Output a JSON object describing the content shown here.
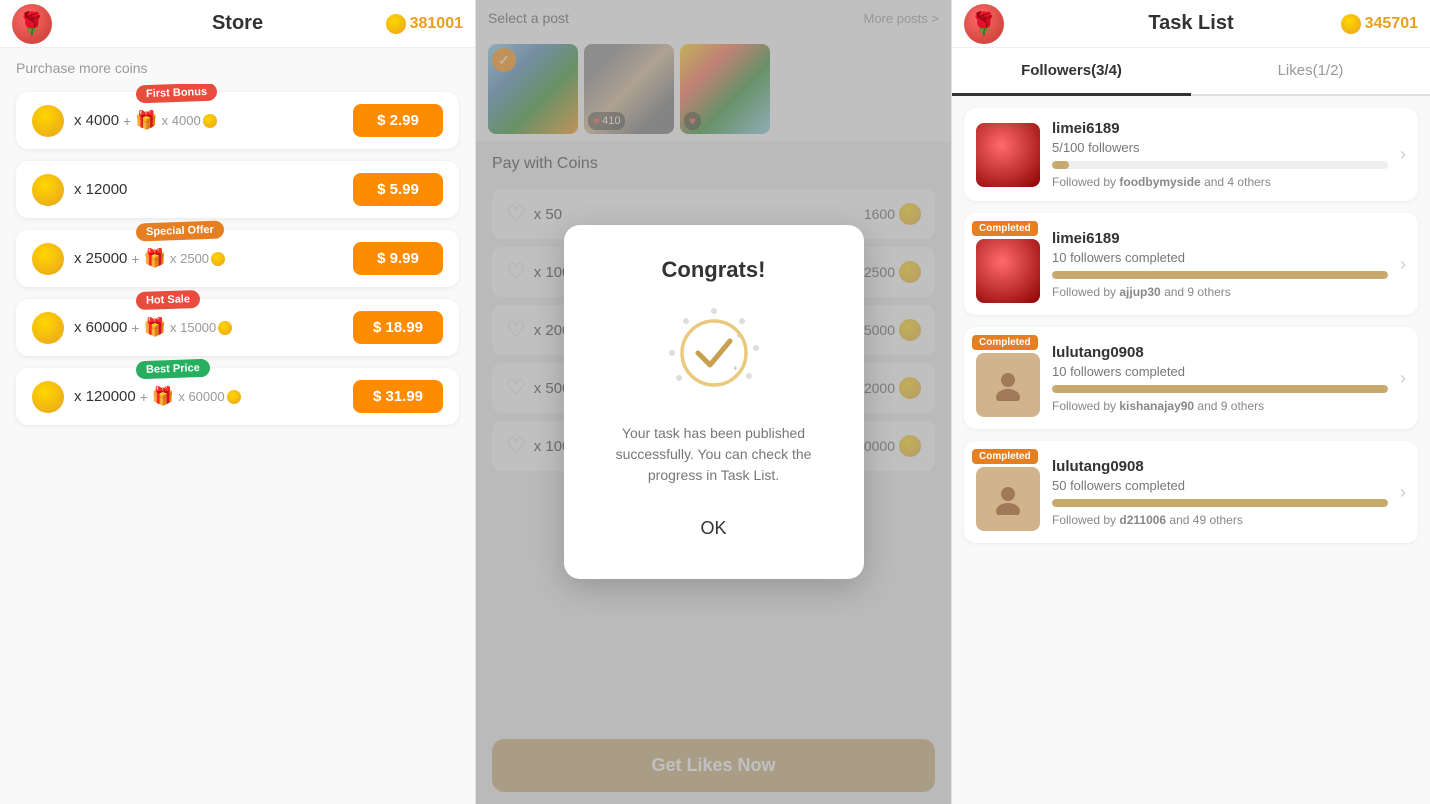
{
  "store": {
    "title": "Store",
    "logo": "🌹",
    "coins": "381001",
    "purchase_label": "Purchase more coins",
    "items": [
      {
        "amount": "x 4000",
        "bonus": "x 4000",
        "badge": "First Bonus",
        "badge_type": "first",
        "price": "$ 2.99",
        "has_gift": true
      },
      {
        "amount": "x 12000",
        "bonus": null,
        "badge": null,
        "badge_type": null,
        "price": "$ 5.99",
        "has_gift": false
      },
      {
        "amount": "x 25000",
        "bonus": "x 2500",
        "badge": "Special Offer",
        "badge_type": "special",
        "price": "$ 9.99",
        "has_gift": true
      },
      {
        "amount": "x 60000",
        "bonus": "x 15000",
        "badge": "Hot Sale",
        "badge_type": "hot",
        "price": "$ 18.99",
        "has_gift": true
      },
      {
        "amount": "x 120000",
        "bonus": "x 60000",
        "badge": "Best Price",
        "badge_type": "best",
        "price": "$ 31.99",
        "has_gift": true
      }
    ]
  },
  "middle": {
    "select_post_label": "Select a post",
    "more_posts_label": "More posts >",
    "pay_with_coins_label": "Pay with Coins",
    "get_likes_btn": "Get Likes Now",
    "likes_options": [
      {
        "count": "x 50",
        "cost": "1600"
      },
      {
        "count": "x 100",
        "cost": "2500"
      },
      {
        "count": "x 200",
        "cost": "5000"
      },
      {
        "count": "x 500",
        "cost": "12000"
      },
      {
        "count": "x 1000",
        "cost": "20000"
      }
    ]
  },
  "modal": {
    "title": "Congrats!",
    "message": "Your task has been published successfully. You can check the progress in Task List.",
    "ok_label": "OK"
  },
  "task_list": {
    "title": "Task List",
    "coins": "345701",
    "tabs": [
      {
        "label": "Followers(3/4)",
        "active": true
      },
      {
        "label": "Likes(1/2)",
        "active": false
      }
    ],
    "items": [
      {
        "username": "limei6189",
        "progress_text": "5/100 followers",
        "progress_pct": 5,
        "followers_text": "Followed by ",
        "followers_bold": "foodbymyside",
        "followers_rest": " and 4 others",
        "completed": false,
        "avatar_type": "rose"
      },
      {
        "username": "limei6189",
        "progress_text": "10 followers completed",
        "progress_pct": 100,
        "followers_text": "Followed by ",
        "followers_bold": "ajjup30",
        "followers_rest": " and 9 others",
        "completed": true,
        "avatar_type": "rose"
      },
      {
        "username": "lulutang0908",
        "progress_text": "10 followers completed",
        "progress_pct": 100,
        "followers_text": "Followed by ",
        "followers_bold": "kishanajay90",
        "followers_rest": " and 9 others",
        "completed": true,
        "avatar_type": "person"
      },
      {
        "username": "lulutang0908",
        "progress_text": "50 followers completed",
        "progress_pct": 100,
        "followers_text": "Followed by ",
        "followers_bold": "d211006",
        "followers_rest": " and 49 others",
        "completed": true,
        "avatar_type": "person"
      }
    ]
  }
}
